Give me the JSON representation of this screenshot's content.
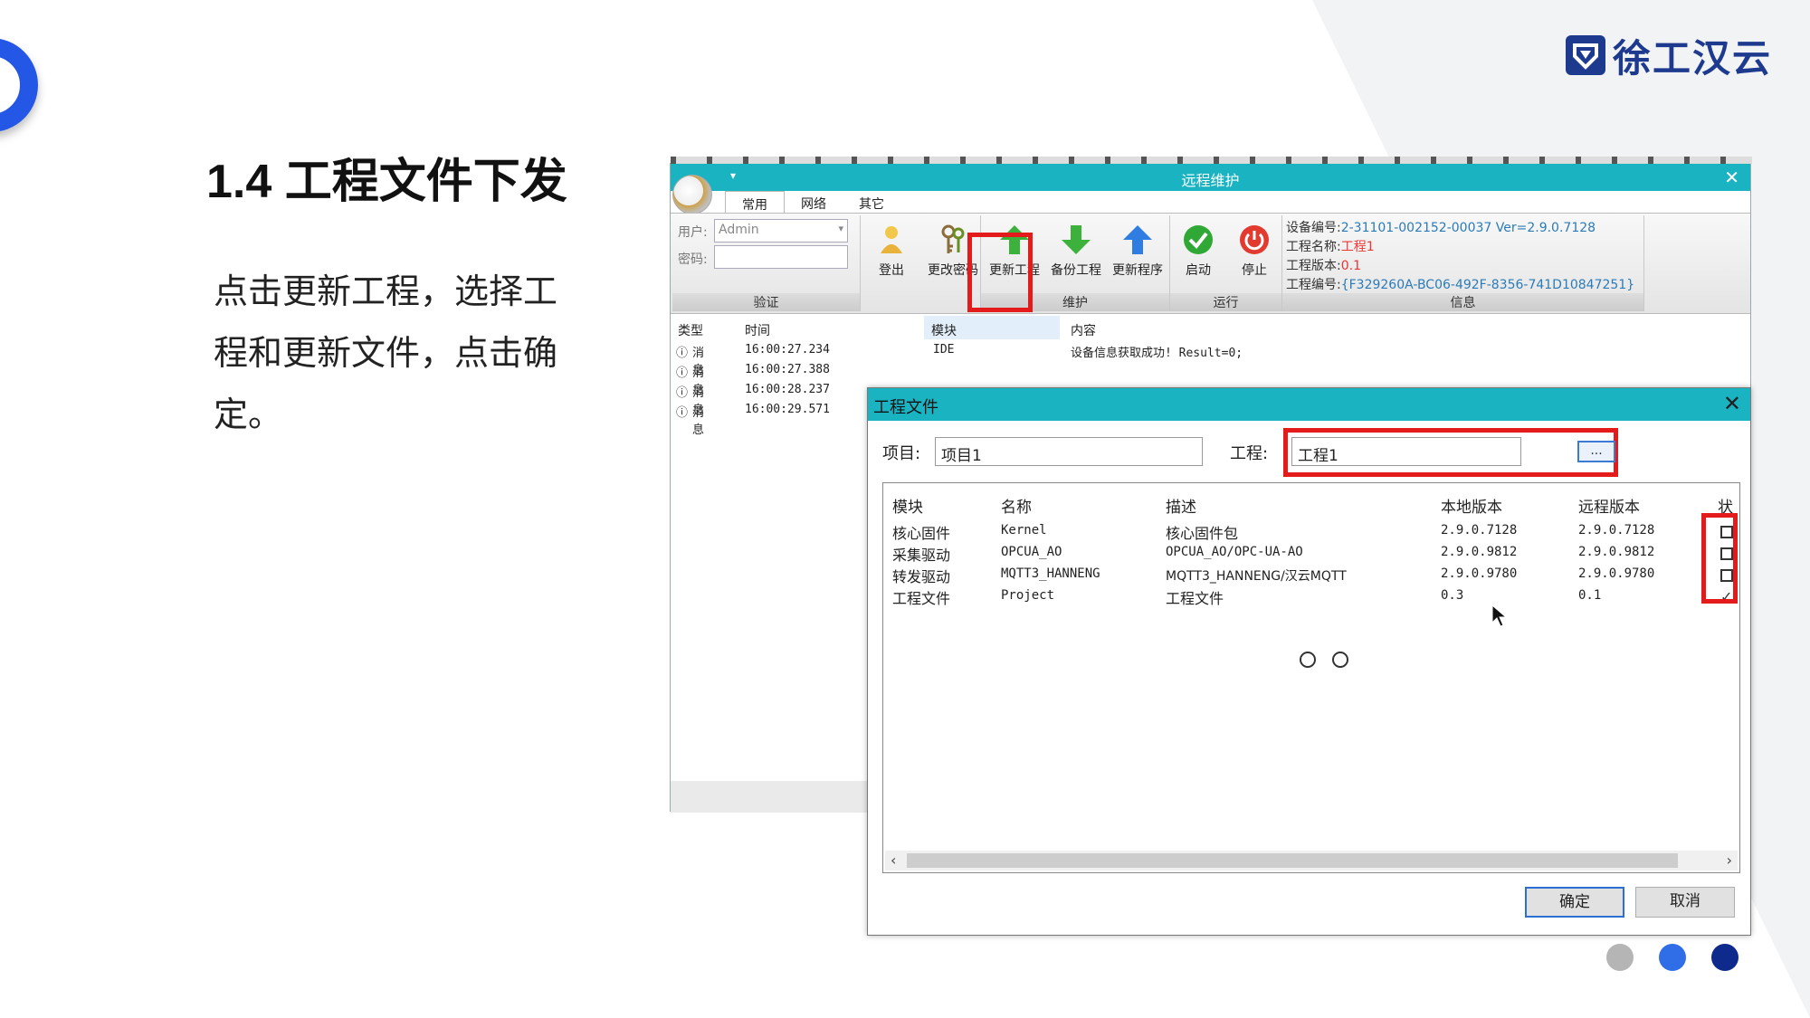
{
  "slide": {
    "title": "1.4 工程文件下发",
    "description": "点击更新工程，选择工程和更新文件，点击确定。",
    "logo_text": "徐工汉云",
    "pager_colors": [
      "#b5b5b5",
      "#2f6ee6",
      "#0d2a8c"
    ]
  },
  "app": {
    "title": "远程维护",
    "tabs": [
      "常用",
      "网络",
      "其它"
    ],
    "auth": {
      "user_label": "用户:",
      "user_value": "Admin",
      "password_label": "密码:",
      "group_label": "验证"
    },
    "buttons": {
      "logout": "登出",
      "change_password": "更改密码",
      "update_project": "更新工程",
      "backup_project": "备份工程",
      "update_program": "更新程序",
      "start": "启动",
      "stop": "停止"
    },
    "groups": {
      "maintain": "维护",
      "run": "运行",
      "info": "信息"
    },
    "info": {
      "device_label": "设备编号:",
      "device_value": "2-31101-002152-00037 Ver=2.9.0.7128",
      "project_name_label": "工程名称:",
      "project_name_value": "工程1",
      "project_version_label": "工程版本:",
      "project_version_value": "0.1",
      "project_id_label": "工程编号:",
      "project_id_value": "{F329260A-BC06-492F-8356-741D10847251}"
    },
    "log": {
      "headers": [
        "类型",
        "时间",
        "模块",
        "内容"
      ],
      "rows": [
        {
          "type": "消息",
          "time": "16:00:27.234",
          "module": "IDE",
          "content": "设备信息获取成功! Result=0;"
        },
        {
          "type": "消息",
          "time": "16:00:27.388"
        },
        {
          "type": "消息",
          "time": "16:00:28.237"
        },
        {
          "type": "消息",
          "time": "16:00:29.571"
        }
      ]
    }
  },
  "dialog": {
    "title": "工程文件",
    "item_label": "项目:",
    "item_value": "项目1",
    "project_label": "工程:",
    "project_value": "工程1",
    "browse_label": "...",
    "columns": [
      "模块",
      "名称",
      "描述",
      "本地版本",
      "远程版本",
      "状"
    ],
    "rows": [
      {
        "module": "核心固件",
        "name": "Kernel",
        "desc": "核心固件包",
        "local": "2.9.0.7128",
        "remote": "2.9.0.7128",
        "checked": false
      },
      {
        "module": "采集驱动",
        "name": "OPCUA_AO",
        "desc": "OPCUA_AO/OPC-UA-AO",
        "local": "2.9.0.9812",
        "remote": "2.9.0.9812",
        "checked": false
      },
      {
        "module": "转发驱动",
        "name": "MQTT3_HANNENG",
        "desc": "MQTT3_HANNENG/汉云MQTT",
        "local": "2.9.0.9780",
        "remote": "2.9.0.9780",
        "checked": false
      },
      {
        "module": "工程文件",
        "name": "Project",
        "desc": "工程文件",
        "local": "0.3",
        "remote": "0.1",
        "checked": true
      }
    ],
    "ok_label": "确定",
    "cancel_label": "取消"
  }
}
